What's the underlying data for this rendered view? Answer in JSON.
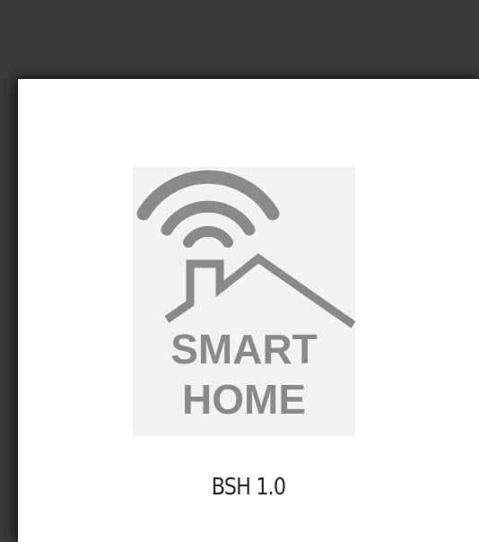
{
  "splash": {
    "logo": {
      "icon": "smart-home-wifi-house-icon",
      "line1": "SMART",
      "line2": "HOME",
      "color": "#8a8a8a",
      "background": "#f2f2f2"
    },
    "version_label": "BSH 1.0"
  },
  "colors": {
    "frame": "#3a3a39",
    "card": "#ffffff"
  }
}
